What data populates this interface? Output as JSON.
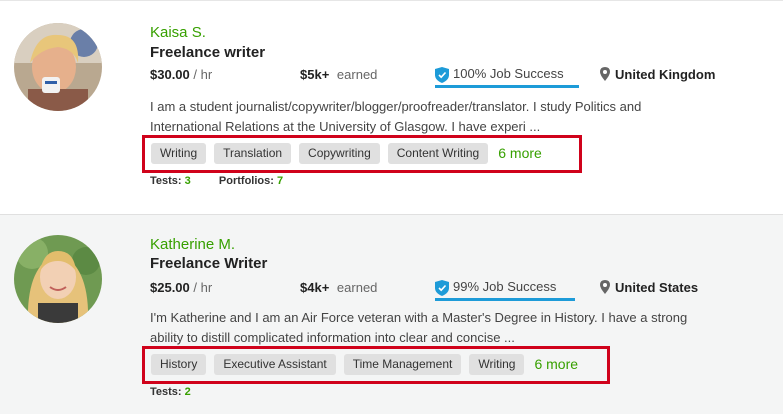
{
  "freelancers": [
    {
      "name": "Kaisa S.",
      "title": "Freelance writer",
      "rate_value": "$30.00",
      "rate_unit": "/ hr",
      "earned_value": "$5k+",
      "earned_label": "earned",
      "job_success": "100% Job Success",
      "location": "United Kingdom",
      "description": "I am a student journalist/copywriter/blogger/proofreader/translator. I study Politics and International Relations at the University of Glasgow. I have experi ...",
      "skills": [
        "Writing",
        "Translation",
        "Copywriting",
        "Content Writing"
      ],
      "more": "6 more",
      "tests_label": "Tests:",
      "tests_value": "3",
      "portfolios_label": "Portfolios:",
      "portfolios_value": "7"
    },
    {
      "name": "Katherine M.",
      "title": "Freelance Writer",
      "rate_value": "$25.00",
      "rate_unit": "/ hr",
      "earned_value": "$4k+",
      "earned_label": "earned",
      "job_success": "99% Job Success",
      "location": "United States",
      "description": "I'm Katherine and I am an Air Force veteran with a Master's Degree in History. I have a strong ability to distill complicated information into clear and concise ...",
      "skills": [
        "History",
        "Executive Assistant",
        "Time Management",
        "Writing"
      ],
      "more": "6 more",
      "tests_label": "Tests:",
      "tests_value": "2"
    }
  ],
  "colors": {
    "name_green": "#37a000",
    "jss_blue": "#1d9bd8",
    "highlight_red": "#d0021b",
    "skill_bg": "#e0e0e0"
  }
}
